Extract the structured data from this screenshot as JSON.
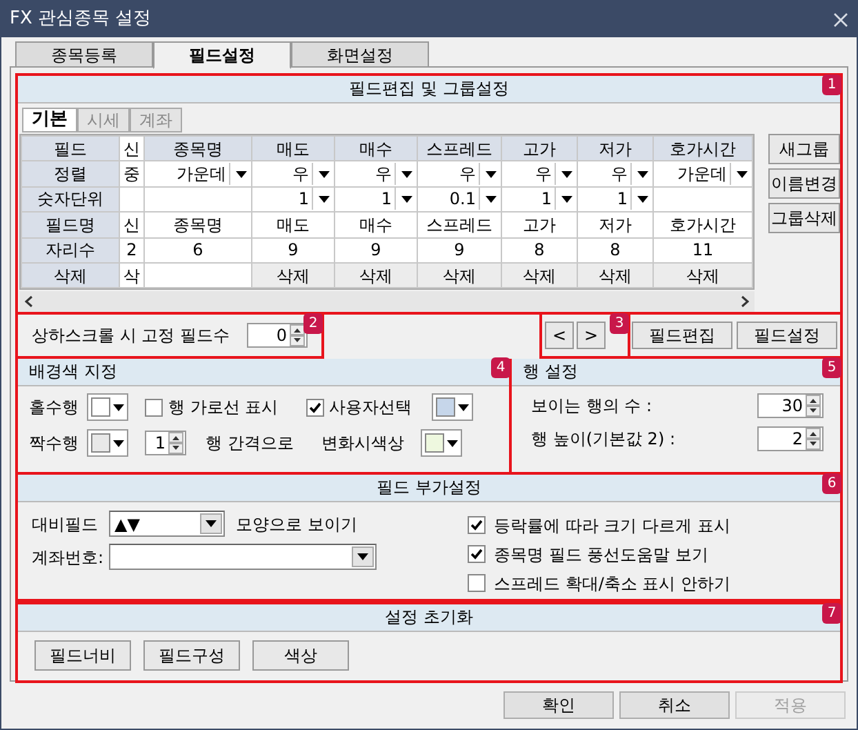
{
  "window": {
    "title": "FX 관심종목 설정"
  },
  "tabs": [
    {
      "label": "종목등록",
      "selected": false
    },
    {
      "label": "필드설정",
      "selected": true
    },
    {
      "label": "화면설정",
      "selected": false
    }
  ],
  "field_group": {
    "badge": "1",
    "title": "필드편집 및 그룹설정",
    "tabs": [
      {
        "label": "기본",
        "selected": true
      },
      {
        "label": "시세",
        "selected": false
      },
      {
        "label": "계좌",
        "selected": false
      }
    ],
    "table": {
      "rows": [
        {
          "label": "필드",
          "cells": [
            {
              "kind": "text",
              "text": "신"
            },
            {
              "kind": "header",
              "text": "종목명"
            },
            {
              "kind": "header",
              "text": "매도"
            },
            {
              "kind": "header",
              "text": "매수"
            },
            {
              "kind": "header",
              "text": "스프레드"
            },
            {
              "kind": "header",
              "text": "고가"
            },
            {
              "kind": "header",
              "text": "저가"
            },
            {
              "kind": "header",
              "text": "호가시간"
            }
          ]
        },
        {
          "label": "정렬",
          "cells": [
            {
              "kind": "text",
              "text": "중"
            },
            {
              "kind": "dropdown",
              "text": "가운데"
            },
            {
              "kind": "dropdown",
              "text": "우"
            },
            {
              "kind": "dropdown",
              "text": "우"
            },
            {
              "kind": "dropdown",
              "text": "우"
            },
            {
              "kind": "dropdown",
              "text": "우"
            },
            {
              "kind": "dropdown",
              "text": "우"
            },
            {
              "kind": "dropdown",
              "text": "가운데"
            }
          ]
        },
        {
          "label": "숫자단위",
          "cells": [
            {
              "kind": "blank"
            },
            {
              "kind": "blank"
            },
            {
              "kind": "dropdown",
              "text": "1"
            },
            {
              "kind": "dropdown",
              "text": "1"
            },
            {
              "kind": "dropdown",
              "text": "0.1"
            },
            {
              "kind": "dropdown",
              "text": "1"
            },
            {
              "kind": "dropdown",
              "text": "1"
            },
            {
              "kind": "blank"
            }
          ]
        },
        {
          "label": "필드명",
          "cells": [
            {
              "kind": "text",
              "text": "신"
            },
            {
              "kind": "text",
              "text": "종목명"
            },
            {
              "kind": "text",
              "text": "매도"
            },
            {
              "kind": "text",
              "text": "매수"
            },
            {
              "kind": "text",
              "text": "스프레드"
            },
            {
              "kind": "text",
              "text": "고가"
            },
            {
              "kind": "text",
              "text": "저가"
            },
            {
              "kind": "text",
              "text": "호가시간"
            }
          ]
        },
        {
          "label": "자리수",
          "cells": [
            {
              "kind": "text",
              "text": "2"
            },
            {
              "kind": "text",
              "text": "6"
            },
            {
              "kind": "text",
              "text": "9"
            },
            {
              "kind": "text",
              "text": "9"
            },
            {
              "kind": "text",
              "text": "9"
            },
            {
              "kind": "text",
              "text": "8"
            },
            {
              "kind": "text",
              "text": "8"
            },
            {
              "kind": "text",
              "text": "11"
            }
          ]
        },
        {
          "label": "삭제",
          "cells": [
            {
              "kind": "text",
              "text": "삭"
            },
            {
              "kind": "blank"
            },
            {
              "kind": "button",
              "text": "삭제"
            },
            {
              "kind": "button",
              "text": "삭제"
            },
            {
              "kind": "button",
              "text": "삭제"
            },
            {
              "kind": "button",
              "text": "삭제"
            },
            {
              "kind": "button",
              "text": "삭제"
            },
            {
              "kind": "button",
              "text": "삭제"
            }
          ]
        }
      ]
    },
    "buttons": [
      "새그룹",
      "이름변경",
      "그룹삭제"
    ]
  },
  "fixed_fields": {
    "badge": "2",
    "label": "상하스크롤 시 고정 필드수",
    "value": "0"
  },
  "navigation": {
    "badge": "3",
    "buttons": [
      "<",
      ">"
    ]
  },
  "field_buttons": [
    "필드편집",
    "필드설정"
  ],
  "background": {
    "badge": "4",
    "title": "배경색 지정",
    "odd_row": {
      "label": "홀수행",
      "color": "#ffffff"
    },
    "horizontal_lines": {
      "label": "행 가로선 표시",
      "checked": false
    },
    "user_select": {
      "label": "사용자선택",
      "checked": true,
      "color": "#c6d6ea"
    },
    "even_row": {
      "label": "짝수행",
      "color": "#e8e8e8"
    },
    "interval": {
      "value": "1",
      "label": "행 간격으로"
    },
    "change_color": {
      "label": "변화시색상",
      "color": "#eef8df"
    }
  },
  "row_settings": {
    "badge": "5",
    "title": "행 설정",
    "fields": [
      {
        "label": "보이는 행의 수 :",
        "value": "30"
      },
      {
        "label": "행 높이(기본값 2) :",
        "value": "2"
      }
    ]
  },
  "extra": {
    "badge": "6",
    "title": "필드 부가설정",
    "compare_field": {
      "label": "대비필드",
      "value": "▲▼",
      "suffix": "모양으로 보이기"
    },
    "account": {
      "label": "계좌번호:"
    },
    "options": [
      {
        "label": "등락률에 따라 크기 다르게 표시",
        "checked": true
      },
      {
        "label": "종목명 필드 풍선도움말 보기",
        "checked": true
      },
      {
        "label": "스프레드 확대/축소 표시 안하기",
        "checked": false
      }
    ]
  },
  "reset": {
    "badge": "7",
    "title": "설정 초기화",
    "buttons": [
      "필드너비",
      "필드구성",
      "색상"
    ]
  },
  "footer_buttons": [
    {
      "label": "확인",
      "disabled": false
    },
    {
      "label": "취소",
      "disabled": false
    },
    {
      "label": "적용",
      "disabled": true
    }
  ]
}
